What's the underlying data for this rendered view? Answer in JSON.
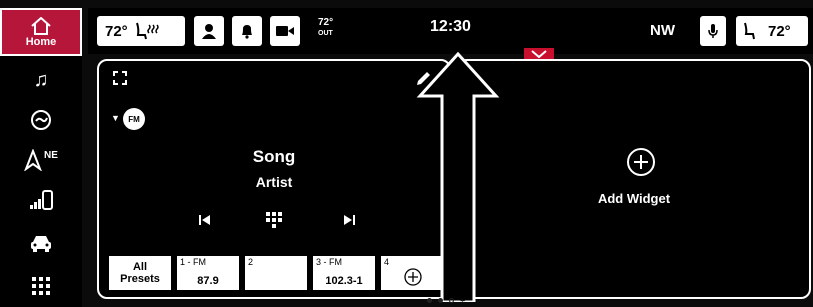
{
  "sidebar": {
    "home_label": "Home",
    "items": [
      {
        "icon": "music-icon"
      },
      {
        "icon": "climate-icon"
      },
      {
        "icon": "navigation-icon",
        "label": "NE"
      },
      {
        "icon": "phone-icon"
      },
      {
        "icon": "vehicle-icon"
      },
      {
        "icon": "apps-grid-icon"
      }
    ]
  },
  "topbar": {
    "driver_temp": "72°",
    "outside_temp": "72°",
    "outside_label": "OUT",
    "clock": "12:30",
    "compass": "NW",
    "passenger_temp": "72°"
  },
  "media": {
    "source_badge": "FM",
    "song": "Song",
    "artist": "Artist"
  },
  "presets": {
    "all_line1": "All",
    "all_line2": "Presets",
    "items": [
      {
        "num": "1 - FM",
        "freq": "87.9"
      },
      {
        "num": "2",
        "freq": ""
      },
      {
        "num": "3 - FM",
        "freq": "102.3-1"
      },
      {
        "num": "4",
        "freq": ""
      }
    ]
  },
  "widget": {
    "add_label": "Add Widget"
  },
  "colors": {
    "accent_red": "#b5163a",
    "pull_tab_red": "#c8102e",
    "background": "#000000",
    "frame": "#e6f0ee"
  }
}
